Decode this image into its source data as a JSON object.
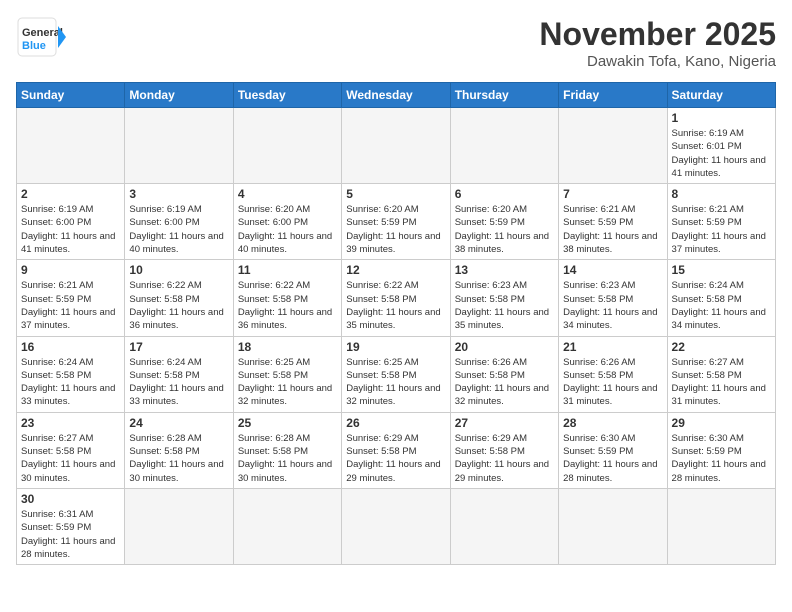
{
  "header": {
    "logo_general": "General",
    "logo_blue": "Blue",
    "month": "November 2025",
    "location": "Dawakin Tofa, Kano, Nigeria"
  },
  "weekdays": [
    "Sunday",
    "Monday",
    "Tuesday",
    "Wednesday",
    "Thursday",
    "Friday",
    "Saturday"
  ],
  "days": {
    "d1": {
      "num": "1",
      "sunrise": "6:19 AM",
      "sunset": "6:01 PM",
      "daylight": "11 hours and 41 minutes."
    },
    "d2": {
      "num": "2",
      "sunrise": "6:19 AM",
      "sunset": "6:00 PM",
      "daylight": "11 hours and 41 minutes."
    },
    "d3": {
      "num": "3",
      "sunrise": "6:19 AM",
      "sunset": "6:00 PM",
      "daylight": "11 hours and 40 minutes."
    },
    "d4": {
      "num": "4",
      "sunrise": "6:20 AM",
      "sunset": "6:00 PM",
      "daylight": "11 hours and 40 minutes."
    },
    "d5": {
      "num": "5",
      "sunrise": "6:20 AM",
      "sunset": "5:59 PM",
      "daylight": "11 hours and 39 minutes."
    },
    "d6": {
      "num": "6",
      "sunrise": "6:20 AM",
      "sunset": "5:59 PM",
      "daylight": "11 hours and 38 minutes."
    },
    "d7": {
      "num": "7",
      "sunrise": "6:21 AM",
      "sunset": "5:59 PM",
      "daylight": "11 hours and 38 minutes."
    },
    "d8": {
      "num": "8",
      "sunrise": "6:21 AM",
      "sunset": "5:59 PM",
      "daylight": "11 hours and 37 minutes."
    },
    "d9": {
      "num": "9",
      "sunrise": "6:21 AM",
      "sunset": "5:59 PM",
      "daylight": "11 hours and 37 minutes."
    },
    "d10": {
      "num": "10",
      "sunrise": "6:22 AM",
      "sunset": "5:58 PM",
      "daylight": "11 hours and 36 minutes."
    },
    "d11": {
      "num": "11",
      "sunrise": "6:22 AM",
      "sunset": "5:58 PM",
      "daylight": "11 hours and 36 minutes."
    },
    "d12": {
      "num": "12",
      "sunrise": "6:22 AM",
      "sunset": "5:58 PM",
      "daylight": "11 hours and 35 minutes."
    },
    "d13": {
      "num": "13",
      "sunrise": "6:23 AM",
      "sunset": "5:58 PM",
      "daylight": "11 hours and 35 minutes."
    },
    "d14": {
      "num": "14",
      "sunrise": "6:23 AM",
      "sunset": "5:58 PM",
      "daylight": "11 hours and 34 minutes."
    },
    "d15": {
      "num": "15",
      "sunrise": "6:24 AM",
      "sunset": "5:58 PM",
      "daylight": "11 hours and 34 minutes."
    },
    "d16": {
      "num": "16",
      "sunrise": "6:24 AM",
      "sunset": "5:58 PM",
      "daylight": "11 hours and 33 minutes."
    },
    "d17": {
      "num": "17",
      "sunrise": "6:24 AM",
      "sunset": "5:58 PM",
      "daylight": "11 hours and 33 minutes."
    },
    "d18": {
      "num": "18",
      "sunrise": "6:25 AM",
      "sunset": "5:58 PM",
      "daylight": "11 hours and 32 minutes."
    },
    "d19": {
      "num": "19",
      "sunrise": "6:25 AM",
      "sunset": "5:58 PM",
      "daylight": "11 hours and 32 minutes."
    },
    "d20": {
      "num": "20",
      "sunrise": "6:26 AM",
      "sunset": "5:58 PM",
      "daylight": "11 hours and 32 minutes."
    },
    "d21": {
      "num": "21",
      "sunrise": "6:26 AM",
      "sunset": "5:58 PM",
      "daylight": "11 hours and 31 minutes."
    },
    "d22": {
      "num": "22",
      "sunrise": "6:27 AM",
      "sunset": "5:58 PM",
      "daylight": "11 hours and 31 minutes."
    },
    "d23": {
      "num": "23",
      "sunrise": "6:27 AM",
      "sunset": "5:58 PM",
      "daylight": "11 hours and 30 minutes."
    },
    "d24": {
      "num": "24",
      "sunrise": "6:28 AM",
      "sunset": "5:58 PM",
      "daylight": "11 hours and 30 minutes."
    },
    "d25": {
      "num": "25",
      "sunrise": "6:28 AM",
      "sunset": "5:58 PM",
      "daylight": "11 hours and 30 minutes."
    },
    "d26": {
      "num": "26",
      "sunrise": "6:29 AM",
      "sunset": "5:58 PM",
      "daylight": "11 hours and 29 minutes."
    },
    "d27": {
      "num": "27",
      "sunrise": "6:29 AM",
      "sunset": "5:58 PM",
      "daylight": "11 hours and 29 minutes."
    },
    "d28": {
      "num": "28",
      "sunrise": "6:30 AM",
      "sunset": "5:59 PM",
      "daylight": "11 hours and 28 minutes."
    },
    "d29": {
      "num": "29",
      "sunrise": "6:30 AM",
      "sunset": "5:59 PM",
      "daylight": "11 hours and 28 minutes."
    },
    "d30": {
      "num": "30",
      "sunrise": "6:31 AM",
      "sunset": "5:59 PM",
      "daylight": "11 hours and 28 minutes."
    }
  },
  "labels": {
    "sunrise": "Sunrise:",
    "sunset": "Sunset:",
    "daylight": "Daylight:"
  }
}
